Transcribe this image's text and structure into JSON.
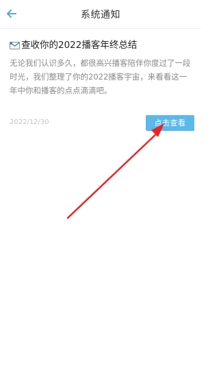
{
  "header": {
    "title": "系统通知",
    "back_icon": "back-arrow-icon",
    "accent_color": "#5aa6d8"
  },
  "message": {
    "title": "查收你的2022播客年终总结",
    "title_icon": "envelope-icon",
    "body": "无论我们认识多久，都很高兴播客陪伴你度过了一段时光，我们整理了你的2022播客宇宙，来看看这一年中你和播客的点点滴滴吧。",
    "date": "2022/12/30",
    "button_label": "点击查看",
    "button_color": "#5bb8ea"
  },
  "annotation": {
    "icon": "red-arrow-icon",
    "color": "#ee2222"
  }
}
